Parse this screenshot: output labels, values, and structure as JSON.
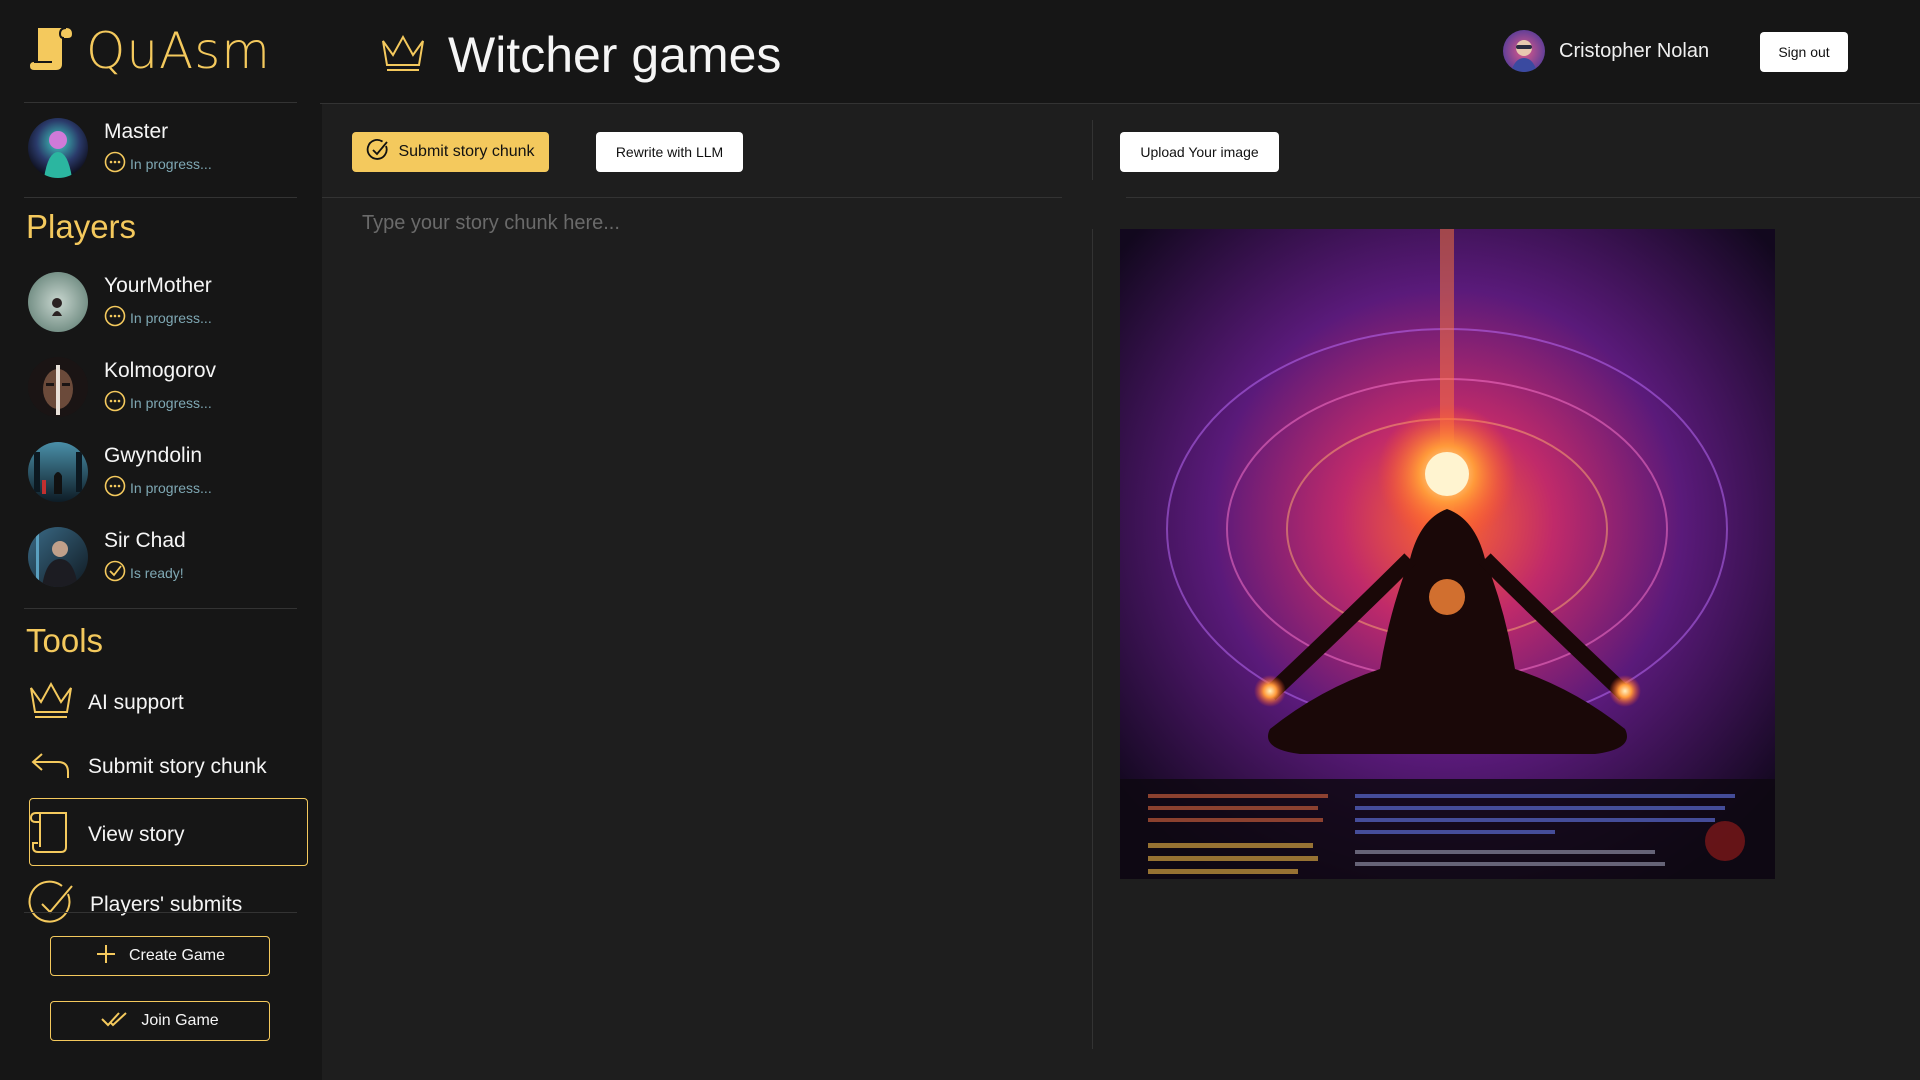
{
  "app": {
    "name": "QuAsm"
  },
  "header": {
    "title": "Witcher games",
    "user_name": "Cristopher Nolan",
    "sign_out_label": "Sign out"
  },
  "master": {
    "name": "Master",
    "status": "In progress..."
  },
  "players_title": "Players",
  "players": [
    {
      "name": "YourMother",
      "status": "In progress...",
      "state": "progress"
    },
    {
      "name": "Kolmogorov",
      "status": "In progress...",
      "state": "progress"
    },
    {
      "name": "Gwyndolin",
      "status": "In progress...",
      "state": "progress"
    },
    {
      "name": "Sir Chad",
      "status": "Is ready!",
      "state": "ready"
    }
  ],
  "tools_title": "Tools",
  "tools": [
    {
      "label": "AI support",
      "icon": "crown-icon"
    },
    {
      "label": "Submit story chunk",
      "icon": "reply-arrow-icon"
    },
    {
      "label": "View story",
      "icon": "scroll-icon",
      "selected": true
    },
    {
      "label": "Players' submits",
      "icon": "check-circle-icon"
    }
  ],
  "actions": {
    "create_game": "Create Game",
    "join_game": "Join Game"
  },
  "editor": {
    "submit_label": "Submit story chunk",
    "rewrite_label": "Rewrite with LLM",
    "placeholder": "Type your story chunk here..."
  },
  "image_panel": {
    "upload_label": "Upload Your image"
  },
  "colors": {
    "accent": "#f4c95d",
    "background": "#1e1e1e",
    "sidebar": "#161616",
    "status": "#7fa8b4"
  }
}
